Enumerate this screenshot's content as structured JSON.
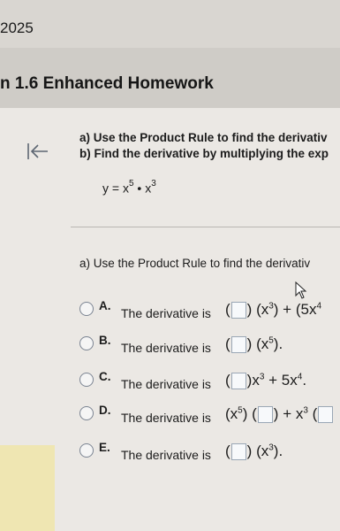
{
  "header": {
    "year": "2025",
    "title": "n 1.6 Enhanced Homework"
  },
  "question": {
    "part_a": "a) Use the Product Rule to find the derivativ",
    "part_b": "b) Find the derivative by multiplying the exp",
    "equation_lhs": "y = x",
    "exp5": "5",
    "dot": " • x",
    "exp3": "3"
  },
  "subquestion": "a) Use the Product Rule to find the derivativ",
  "options": [
    {
      "letter": "A.",
      "text": "The derivative is"
    },
    {
      "letter": "B.",
      "text": "The derivative is"
    },
    {
      "letter": "C.",
      "text": "The derivative is"
    },
    {
      "letter": "D.",
      "text": "The derivative is"
    },
    {
      "letter": "E.",
      "text": "The derivative is"
    }
  ],
  "math": {
    "A_mid": "(x",
    "A_exp": "3",
    "A_tail": ") + (5x",
    "A_exp2": "4",
    "B_mid": "(x",
    "B_exp": "5",
    "B_tail": ").",
    "C_mid": "x",
    "C_exp": "3",
    "C_plus": " + 5x",
    "C_exp2": "4",
    "C_tail": ".",
    "D_lead": "(x",
    "D_exp": "5",
    "D_close": ")",
    "D_tail": " + x",
    "D_exp2": "3",
    "D_open": " (",
    "E_mid": "(x",
    "E_exp": "3",
    "E_tail": ")."
  },
  "colors": {
    "radio_border": "#7b8492",
    "answer_box_border": "#9aa7b5"
  }
}
